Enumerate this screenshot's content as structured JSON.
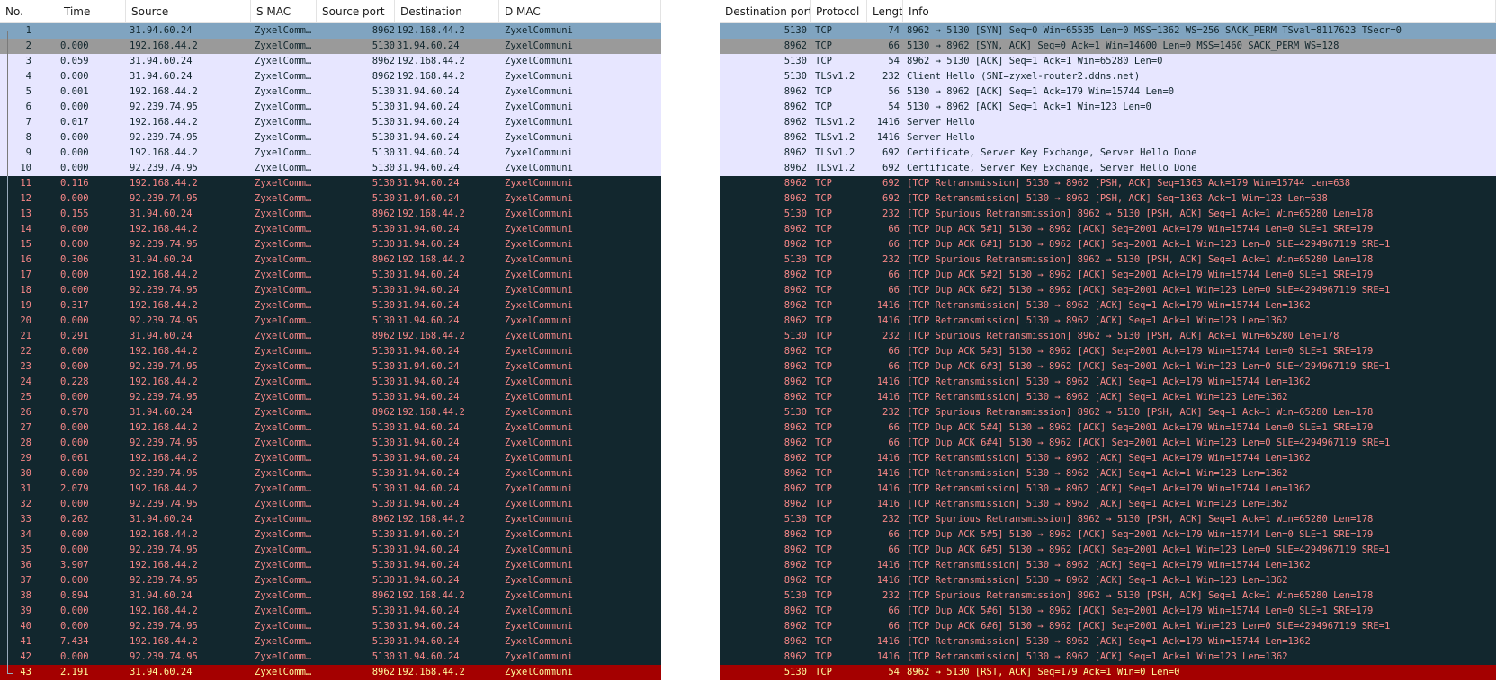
{
  "left_columns": [
    "No.",
    "Time",
    "Source",
    "S MAC",
    "Source port",
    "Destination",
    "D MAC"
  ],
  "right_columns": [
    "Destination port",
    "Protocol",
    "Length",
    "Info"
  ],
  "packets": [
    {
      "no": "1",
      "time": "",
      "src": "31.94.60.24",
      "smac": "ZyxelComm…",
      "sport": "8962",
      "dst": "192.168.44.2",
      "dmac": "ZyxelCommuni",
      "dport": "5130",
      "proto": "TCP",
      "len": "74",
      "info": "8962 → 5130 [SYN] Seq=0 Win=65535 Len=0 MSS=1362 WS=256 SACK_PERM TSval=8117623 TSecr=0",
      "style": "sel1"
    },
    {
      "no": "2",
      "time": "0.000",
      "src": "192.168.44.2",
      "smac": "ZyxelComm…",
      "sport": "5130",
      "dst": "31.94.60.24",
      "dmac": "ZyxelCommuni",
      "dport": "8962",
      "proto": "TCP",
      "len": "66",
      "info": "5130 → 8962 [SYN, ACK] Seq=0 Ack=1 Win=14600 Len=0 MSS=1460 SACK_PERM WS=128",
      "style": "sel2"
    },
    {
      "no": "3",
      "time": "0.059",
      "src": "31.94.60.24",
      "smac": "ZyxelComm…",
      "sport": "8962",
      "dst": "192.168.44.2",
      "dmac": "ZyxelCommuni",
      "dport": "5130",
      "proto": "TCP",
      "len": "54",
      "info": "8962 → 5130 [ACK] Seq=1 Ack=1 Win=65280 Len=0",
      "style": "norm"
    },
    {
      "no": "4",
      "time": "0.000",
      "src": "31.94.60.24",
      "smac": "ZyxelComm…",
      "sport": "8962",
      "dst": "192.168.44.2",
      "dmac": "ZyxelCommuni",
      "dport": "5130",
      "proto": "TLSv1.2",
      "len": "232",
      "info": "Client Hello (SNI=zyxel-router2.ddns.net)",
      "style": "norm"
    },
    {
      "no": "5",
      "time": "0.001",
      "src": "192.168.44.2",
      "smac": "ZyxelComm…",
      "sport": "5130",
      "dst": "31.94.60.24",
      "dmac": "ZyxelCommuni",
      "dport": "8962",
      "proto": "TCP",
      "len": "56",
      "info": "5130 → 8962 [ACK] Seq=1 Ack=179 Win=15744 Len=0",
      "style": "norm"
    },
    {
      "no": "6",
      "time": "0.000",
      "src": "92.239.74.95",
      "smac": "ZyxelComm…",
      "sport": "5130",
      "dst": "31.94.60.24",
      "dmac": "ZyxelCommuni",
      "dport": "8962",
      "proto": "TCP",
      "len": "54",
      "info": "5130 → 8962 [ACK] Seq=1 Ack=1 Win=123 Len=0",
      "style": "norm"
    },
    {
      "no": "7",
      "time": "0.017",
      "src": "192.168.44.2",
      "smac": "ZyxelComm…",
      "sport": "5130",
      "dst": "31.94.60.24",
      "dmac": "ZyxelCommuni",
      "dport": "8962",
      "proto": "TLSv1.2",
      "len": "1416",
      "info": "Server Hello",
      "style": "norm"
    },
    {
      "no": "8",
      "time": "0.000",
      "src": "92.239.74.95",
      "smac": "ZyxelComm…",
      "sport": "5130",
      "dst": "31.94.60.24",
      "dmac": "ZyxelCommuni",
      "dport": "8962",
      "proto": "TLSv1.2",
      "len": "1416",
      "info": "Server Hello",
      "style": "norm"
    },
    {
      "no": "9",
      "time": "0.000",
      "src": "192.168.44.2",
      "smac": "ZyxelComm…",
      "sport": "5130",
      "dst": "31.94.60.24",
      "dmac": "ZyxelCommuni",
      "dport": "8962",
      "proto": "TLSv1.2",
      "len": "692",
      "info": "Certificate, Server Key Exchange, Server Hello Done",
      "style": "norm"
    },
    {
      "no": "10",
      "time": "0.000",
      "src": "92.239.74.95",
      "smac": "ZyxelComm…",
      "sport": "5130",
      "dst": "31.94.60.24",
      "dmac": "ZyxelCommuni",
      "dport": "8962",
      "proto": "TLSv1.2",
      "len": "692",
      "info": "Certificate, Server Key Exchange, Server Hello Done",
      "style": "norm"
    },
    {
      "no": "11",
      "time": "0.116",
      "src": "192.168.44.2",
      "smac": "ZyxelComm…",
      "sport": "5130",
      "dst": "31.94.60.24",
      "dmac": "ZyxelCommuni",
      "dport": "8962",
      "proto": "TCP",
      "len": "692",
      "info": "[TCP Retransmission] 5130 → 8962 [PSH, ACK] Seq=1363 Ack=179 Win=15744 Len=638",
      "style": "bad"
    },
    {
      "no": "12",
      "time": "0.000",
      "src": "92.239.74.95",
      "smac": "ZyxelComm…",
      "sport": "5130",
      "dst": "31.94.60.24",
      "dmac": "ZyxelCommuni",
      "dport": "8962",
      "proto": "TCP",
      "len": "692",
      "info": "[TCP Retransmission] 5130 → 8962 [PSH, ACK] Seq=1363 Ack=1 Win=123 Len=638",
      "style": "bad"
    },
    {
      "no": "13",
      "time": "0.155",
      "src": "31.94.60.24",
      "smac": "ZyxelComm…",
      "sport": "8962",
      "dst": "192.168.44.2",
      "dmac": "ZyxelCommuni",
      "dport": "5130",
      "proto": "TCP",
      "len": "232",
      "info": "[TCP Spurious Retransmission] 8962 → 5130 [PSH, ACK] Seq=1 Ack=1 Win=65280 Len=178",
      "style": "bad"
    },
    {
      "no": "14",
      "time": "0.000",
      "src": "192.168.44.2",
      "smac": "ZyxelComm…",
      "sport": "5130",
      "dst": "31.94.60.24",
      "dmac": "ZyxelCommuni",
      "dport": "8962",
      "proto": "TCP",
      "len": "66",
      "info": "[TCP Dup ACK 5#1] 5130 → 8962 [ACK] Seq=2001 Ack=179 Win=15744 Len=0 SLE=1 SRE=179",
      "style": "bad"
    },
    {
      "no": "15",
      "time": "0.000",
      "src": "92.239.74.95",
      "smac": "ZyxelComm…",
      "sport": "5130",
      "dst": "31.94.60.24",
      "dmac": "ZyxelCommuni",
      "dport": "8962",
      "proto": "TCP",
      "len": "66",
      "info": "[TCP Dup ACK 6#1] 5130 → 8962 [ACK] Seq=2001 Ack=1 Win=123 Len=0 SLE=4294967119 SRE=1",
      "style": "bad"
    },
    {
      "no": "16",
      "time": "0.306",
      "src": "31.94.60.24",
      "smac": "ZyxelComm…",
      "sport": "8962",
      "dst": "192.168.44.2",
      "dmac": "ZyxelCommuni",
      "dport": "5130",
      "proto": "TCP",
      "len": "232",
      "info": "[TCP Spurious Retransmission] 8962 → 5130 [PSH, ACK] Seq=1 Ack=1 Win=65280 Len=178",
      "style": "bad"
    },
    {
      "no": "17",
      "time": "0.000",
      "src": "192.168.44.2",
      "smac": "ZyxelComm…",
      "sport": "5130",
      "dst": "31.94.60.24",
      "dmac": "ZyxelCommuni",
      "dport": "8962",
      "proto": "TCP",
      "len": "66",
      "info": "[TCP Dup ACK 5#2] 5130 → 8962 [ACK] Seq=2001 Ack=179 Win=15744 Len=0 SLE=1 SRE=179",
      "style": "bad"
    },
    {
      "no": "18",
      "time": "0.000",
      "src": "92.239.74.95",
      "smac": "ZyxelComm…",
      "sport": "5130",
      "dst": "31.94.60.24",
      "dmac": "ZyxelCommuni",
      "dport": "8962",
      "proto": "TCP",
      "len": "66",
      "info": "[TCP Dup ACK 6#2] 5130 → 8962 [ACK] Seq=2001 Ack=1 Win=123 Len=0 SLE=4294967119 SRE=1",
      "style": "bad"
    },
    {
      "no": "19",
      "time": "0.317",
      "src": "192.168.44.2",
      "smac": "ZyxelComm…",
      "sport": "5130",
      "dst": "31.94.60.24",
      "dmac": "ZyxelCommuni",
      "dport": "8962",
      "proto": "TCP",
      "len": "1416",
      "info": "[TCP Retransmission] 5130 → 8962 [ACK] Seq=1 Ack=179 Win=15744 Len=1362",
      "style": "bad"
    },
    {
      "no": "20",
      "time": "0.000",
      "src": "92.239.74.95",
      "smac": "ZyxelComm…",
      "sport": "5130",
      "dst": "31.94.60.24",
      "dmac": "ZyxelCommuni",
      "dport": "8962",
      "proto": "TCP",
      "len": "1416",
      "info": "[TCP Retransmission] 5130 → 8962 [ACK] Seq=1 Ack=1 Win=123 Len=1362",
      "style": "bad"
    },
    {
      "no": "21",
      "time": "0.291",
      "src": "31.94.60.24",
      "smac": "ZyxelComm…",
      "sport": "8962",
      "dst": "192.168.44.2",
      "dmac": "ZyxelCommuni",
      "dport": "5130",
      "proto": "TCP",
      "len": "232",
      "info": "[TCP Spurious Retransmission] 8962 → 5130 [PSH, ACK] Ack=1 Win=65280 Len=178",
      "style": "bad"
    },
    {
      "no": "22",
      "time": "0.000",
      "src": "192.168.44.2",
      "smac": "ZyxelComm…",
      "sport": "5130",
      "dst": "31.94.60.24",
      "dmac": "ZyxelCommuni",
      "dport": "8962",
      "proto": "TCP",
      "len": "66",
      "info": "[TCP Dup ACK 5#3] 5130 → 8962 [ACK] Seq=2001 Ack=179 Win=15744 Len=0 SLE=1 SRE=179",
      "style": "bad"
    },
    {
      "no": "23",
      "time": "0.000",
      "src": "92.239.74.95",
      "smac": "ZyxelComm…",
      "sport": "5130",
      "dst": "31.94.60.24",
      "dmac": "ZyxelCommuni",
      "dport": "8962",
      "proto": "TCP",
      "len": "66",
      "info": "[TCP Dup ACK 6#3] 5130 → 8962 [ACK] Seq=2001 Ack=1 Win=123 Len=0 SLE=4294967119 SRE=1",
      "style": "bad"
    },
    {
      "no": "24",
      "time": "0.228",
      "src": "192.168.44.2",
      "smac": "ZyxelComm…",
      "sport": "5130",
      "dst": "31.94.60.24",
      "dmac": "ZyxelCommuni",
      "dport": "8962",
      "proto": "TCP",
      "len": "1416",
      "info": "[TCP Retransmission] 5130 → 8962 [ACK] Seq=1 Ack=179 Win=15744 Len=1362",
      "style": "bad"
    },
    {
      "no": "25",
      "time": "0.000",
      "src": "92.239.74.95",
      "smac": "ZyxelComm…",
      "sport": "5130",
      "dst": "31.94.60.24",
      "dmac": "ZyxelCommuni",
      "dport": "8962",
      "proto": "TCP",
      "len": "1416",
      "info": "[TCP Retransmission] 5130 → 8962 [ACK] Seq=1 Ack=1 Win=123 Len=1362",
      "style": "bad"
    },
    {
      "no": "26",
      "time": "0.978",
      "src": "31.94.60.24",
      "smac": "ZyxelComm…",
      "sport": "8962",
      "dst": "192.168.44.2",
      "dmac": "ZyxelCommuni",
      "dport": "5130",
      "proto": "TCP",
      "len": "232",
      "info": "[TCP Spurious Retransmission] 8962 → 5130 [PSH, ACK] Seq=1 Ack=1 Win=65280 Len=178",
      "style": "bad"
    },
    {
      "no": "27",
      "time": "0.000",
      "src": "192.168.44.2",
      "smac": "ZyxelComm…",
      "sport": "5130",
      "dst": "31.94.60.24",
      "dmac": "ZyxelCommuni",
      "dport": "8962",
      "proto": "TCP",
      "len": "66",
      "info": "[TCP Dup ACK 5#4] 5130 → 8962 [ACK] Seq=2001 Ack=179 Win=15744 Len=0 SLE=1 SRE=179",
      "style": "bad"
    },
    {
      "no": "28",
      "time": "0.000",
      "src": "92.239.74.95",
      "smac": "ZyxelComm…",
      "sport": "5130",
      "dst": "31.94.60.24",
      "dmac": "ZyxelCommuni",
      "dport": "8962",
      "proto": "TCP",
      "len": "66",
      "info": "[TCP Dup ACK 6#4] 5130 → 8962 [ACK] Seq=2001 Ack=1 Win=123 Len=0 SLE=4294967119 SRE=1",
      "style": "bad"
    },
    {
      "no": "29",
      "time": "0.061",
      "src": "192.168.44.2",
      "smac": "ZyxelComm…",
      "sport": "5130",
      "dst": "31.94.60.24",
      "dmac": "ZyxelCommuni",
      "dport": "8962",
      "proto": "TCP",
      "len": "1416",
      "info": "[TCP Retransmission] 5130 → 8962 [ACK] Seq=1 Ack=179 Win=15744 Len=1362",
      "style": "bad"
    },
    {
      "no": "30",
      "time": "0.000",
      "src": "92.239.74.95",
      "smac": "ZyxelComm…",
      "sport": "5130",
      "dst": "31.94.60.24",
      "dmac": "ZyxelCommuni",
      "dport": "8962",
      "proto": "TCP",
      "len": "1416",
      "info": "[TCP Retransmission] 5130 → 8962 [ACK] Seq=1 Ack=1 Win=123 Len=1362",
      "style": "bad"
    },
    {
      "no": "31",
      "time": "2.079",
      "src": "192.168.44.2",
      "smac": "ZyxelComm…",
      "sport": "5130",
      "dst": "31.94.60.24",
      "dmac": "ZyxelCommuni",
      "dport": "8962",
      "proto": "TCP",
      "len": "1416",
      "info": "[TCP Retransmission] 5130 → 8962 [ACK] Seq=1 Ack=179 Win=15744 Len=1362",
      "style": "bad"
    },
    {
      "no": "32",
      "time": "0.000",
      "src": "92.239.74.95",
      "smac": "ZyxelComm…",
      "sport": "5130",
      "dst": "31.94.60.24",
      "dmac": "ZyxelCommuni",
      "dport": "8962",
      "proto": "TCP",
      "len": "1416",
      "info": "[TCP Retransmission] 5130 → 8962 [ACK] Seq=1 Ack=1 Win=123 Len=1362",
      "style": "bad"
    },
    {
      "no": "33",
      "time": "0.262",
      "src": "31.94.60.24",
      "smac": "ZyxelComm…",
      "sport": "8962",
      "dst": "192.168.44.2",
      "dmac": "ZyxelCommuni",
      "dport": "5130",
      "proto": "TCP",
      "len": "232",
      "info": "[TCP Spurious Retransmission] 8962 → 5130 [PSH, ACK] Seq=1 Ack=1 Win=65280 Len=178",
      "style": "bad"
    },
    {
      "no": "34",
      "time": "0.000",
      "src": "192.168.44.2",
      "smac": "ZyxelComm…",
      "sport": "5130",
      "dst": "31.94.60.24",
      "dmac": "ZyxelCommuni",
      "dport": "8962",
      "proto": "TCP",
      "len": "66",
      "info": "[TCP Dup ACK 5#5] 5130 → 8962 [ACK] Seq=2001 Ack=179 Win=15744 Len=0 SLE=1 SRE=179",
      "style": "bad"
    },
    {
      "no": "35",
      "time": "0.000",
      "src": "92.239.74.95",
      "smac": "ZyxelComm…",
      "sport": "5130",
      "dst": "31.94.60.24",
      "dmac": "ZyxelCommuni",
      "dport": "8962",
      "proto": "TCP",
      "len": "66",
      "info": "[TCP Dup ACK 6#5] 5130 → 8962 [ACK] Seq=2001 Ack=1 Win=123 Len=0 SLE=4294967119 SRE=1",
      "style": "bad"
    },
    {
      "no": "36",
      "time": "3.907",
      "src": "192.168.44.2",
      "smac": "ZyxelComm…",
      "sport": "5130",
      "dst": "31.94.60.24",
      "dmac": "ZyxelCommuni",
      "dport": "8962",
      "proto": "TCP",
      "len": "1416",
      "info": "[TCP Retransmission] 5130 → 8962 [ACK] Seq=1 Ack=179 Win=15744 Len=1362",
      "style": "bad"
    },
    {
      "no": "37",
      "time": "0.000",
      "src": "92.239.74.95",
      "smac": "ZyxelComm…",
      "sport": "5130",
      "dst": "31.94.60.24",
      "dmac": "ZyxelCommuni",
      "dport": "8962",
      "proto": "TCP",
      "len": "1416",
      "info": "[TCP Retransmission] 5130 → 8962 [ACK] Seq=1 Ack=1 Win=123 Len=1362",
      "style": "bad"
    },
    {
      "no": "38",
      "time": "0.894",
      "src": "31.94.60.24",
      "smac": "ZyxelComm…",
      "sport": "8962",
      "dst": "192.168.44.2",
      "dmac": "ZyxelCommuni",
      "dport": "5130",
      "proto": "TCP",
      "len": "232",
      "info": "[TCP Spurious Retransmission] 8962 → 5130 [PSH, ACK] Seq=1 Ack=1 Win=65280 Len=178",
      "style": "bad"
    },
    {
      "no": "39",
      "time": "0.000",
      "src": "192.168.44.2",
      "smac": "ZyxelComm…",
      "sport": "5130",
      "dst": "31.94.60.24",
      "dmac": "ZyxelCommuni",
      "dport": "8962",
      "proto": "TCP",
      "len": "66",
      "info": "[TCP Dup ACK 5#6] 5130 → 8962 [ACK] Seq=2001 Ack=179 Win=15744 Len=0 SLE=1 SRE=179",
      "style": "bad"
    },
    {
      "no": "40",
      "time": "0.000",
      "src": "92.239.74.95",
      "smac": "ZyxelComm…",
      "sport": "5130",
      "dst": "31.94.60.24",
      "dmac": "ZyxelCommuni",
      "dport": "8962",
      "proto": "TCP",
      "len": "66",
      "info": "[TCP Dup ACK 6#6] 5130 → 8962 [ACK] Seq=2001 Ack=1 Win=123 Len=0 SLE=4294967119 SRE=1",
      "style": "bad"
    },
    {
      "no": "41",
      "time": "7.434",
      "src": "192.168.44.2",
      "smac": "ZyxelComm…",
      "sport": "5130",
      "dst": "31.94.60.24",
      "dmac": "ZyxelCommuni",
      "dport": "8962",
      "proto": "TCP",
      "len": "1416",
      "info": "[TCP Retransmission] 5130 → 8962 [ACK] Seq=1 Ack=179 Win=15744 Len=1362",
      "style": "bad"
    },
    {
      "no": "42",
      "time": "0.000",
      "src": "92.239.74.95",
      "smac": "ZyxelComm…",
      "sport": "5130",
      "dst": "31.94.60.24",
      "dmac": "ZyxelCommuni",
      "dport": "8962",
      "proto": "TCP",
      "len": "1416",
      "info": "[TCP Retransmission] 5130 → 8962 [ACK] Seq=1 Ack=1 Win=123 Len=1362",
      "style": "bad"
    },
    {
      "no": "43",
      "time": "2.191",
      "src": "31.94.60.24",
      "smac": "ZyxelComm…",
      "sport": "8962",
      "dst": "192.168.44.2",
      "dmac": "ZyxelCommuni",
      "dport": "5130",
      "proto": "TCP",
      "len": "54",
      "info": "8962 → 5130 [RST, ACK] Seq=179 Ack=1 Win=0 Len=0",
      "style": "rst"
    }
  ],
  "colors": {
    "normal_bg": "#e7e6ff",
    "normal_fg": "#12272e",
    "bad_bg": "#12272e",
    "bad_fg": "#f78787",
    "rst_bg": "#a40000",
    "rst_fg": "#fffc9c",
    "selected_bg": "#80a4c0",
    "related_bg": "#9a9a9a"
  }
}
